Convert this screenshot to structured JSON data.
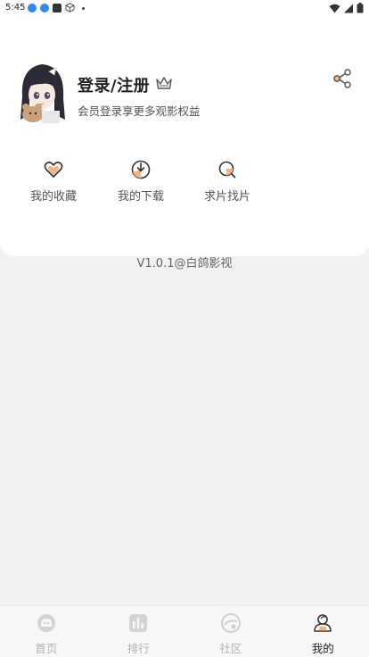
{
  "status_bar": {
    "time": "5:45"
  },
  "profile": {
    "login_title": "登录/注册",
    "subtitle": "会员登录享更多观影权益"
  },
  "quick_actions": [
    {
      "label": "我的收藏",
      "icon": "heart-icon"
    },
    {
      "label": "我的下载",
      "icon": "download-icon"
    },
    {
      "label": "求片找片",
      "icon": "search-film-icon"
    }
  ],
  "version_text": "V1.0.1@白鸽影视",
  "bottom_nav": [
    {
      "label": "首页",
      "icon": "home-icon",
      "active": false
    },
    {
      "label": "排行",
      "icon": "ranking-icon",
      "active": false
    },
    {
      "label": "社区",
      "icon": "community-icon",
      "active": false
    },
    {
      "label": "我的",
      "icon": "profile-icon",
      "active": true
    }
  ],
  "colors": {
    "accent": "#f4b183",
    "background": "#f2f2f2",
    "card": "#ffffff",
    "nav_inactive": "#b3b3b3"
  }
}
